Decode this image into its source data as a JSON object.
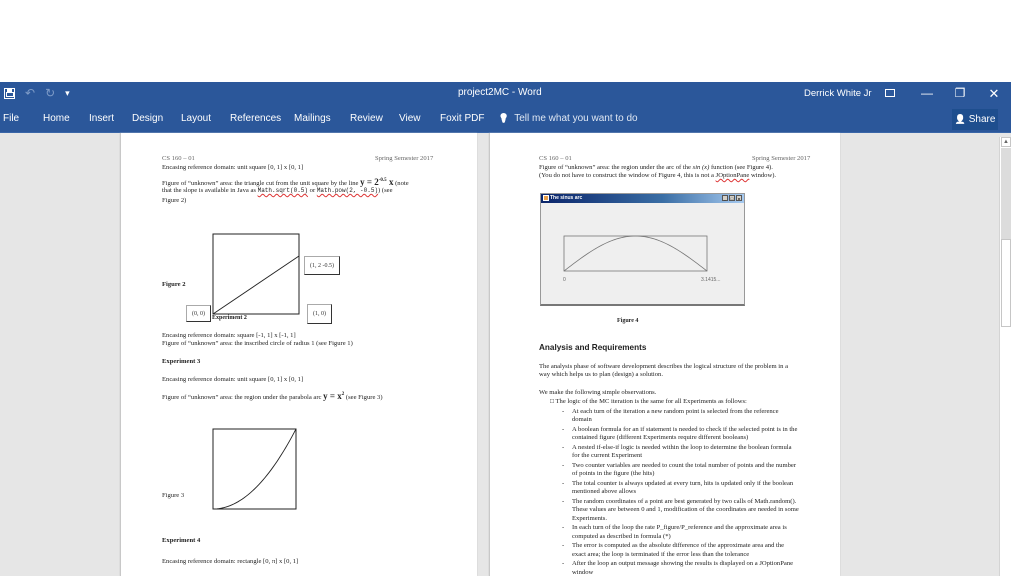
{
  "window": {
    "doc_title": "project2MC  -  Word",
    "user": "Derrick White Jr",
    "qat": {
      "undo": "↶",
      "redo": "↻",
      "customize": "▾"
    },
    "controls": {
      "ribbon_display": "▣",
      "minimize": "—",
      "restore": "❐",
      "close": "✕"
    }
  },
  "ribbon": {
    "tabs": [
      "File",
      "Home",
      "Insert",
      "Design",
      "Layout",
      "References",
      "Mailings",
      "Review",
      "View",
      "Foxit PDF"
    ],
    "tell_me": "Tell me what you want to do",
    "tell_me_icon": "💡",
    "share": "Share",
    "share_icon": "👤"
  },
  "page1": {
    "header_left": "CS 160 – 01",
    "header_right": "Spring Semester 2017",
    "exp2_domain": "Encasing reference domain: unit square [0, 1] x [0, 1]",
    "exp2_figure_a": "Figure of “unknown” area: the triangle cut from the unit square by the line",
    "exp2_eq_y": "y = 2",
    "exp2_eq_exp": "-0.5",
    "exp2_eq_x": "x",
    "exp2_note": "(note",
    "exp2_line2_a": "that the slope is available in Java as",
    "exp2_code1": "Math.sqrt(0.5)",
    "exp2_line2_b": "or",
    "exp2_code2": "Math.pow(2, -0.5)",
    "exp2_line2_c": ") (see",
    "exp2_line3": "Figure 2)",
    "fig2_label": "Figure 2",
    "fig2_corner_top": "(1, 2 -0.5)",
    "fig2_corner_origin": "(0, 0)",
    "fig2_corner_right": "(1, 0)",
    "exp2_caption": "Experiment 2",
    "exp1_domain": "Encasing reference domain: square [-1, 1] x [-1, 1]",
    "exp1_figure": "Figure of “unknown” area: the inscribed circle of radius 1 (see Figure 1)",
    "exp3_heading": "Experiment 3",
    "exp3_domain": "Encasing reference domain: unit square [0, 1] x [0, 1]",
    "exp3_figure": "Figure of “unknown” area: the region under the parabola arc",
    "exp3_eq": "y = x",
    "exp3_eq_sup": "2",
    "exp3_see": "(see Figure 3)",
    "fig3_label": "Figure 3",
    "exp4_heading": "Experiment 4",
    "exp4_domain": "Encasing reference domain: rectangle [0, π] x [0, 1]"
  },
  "page2": {
    "header_left": "CS 160 – 01",
    "header_right": "Spring Semester 2017",
    "exp4_figure_a": "Figure of “unknown” area: the region under the arc of the",
    "exp4_sin": "sin (x)",
    "exp4_figure_b": "function (see Figure 4).",
    "exp4_note_a": "(You do not have to construct the window of Figure 4, this is not a",
    "exp4_note_code": "JOptionPane",
    "exp4_note_b": "window).",
    "java_window_title": "The sinus arc",
    "java_ctrls": [
      "_",
      "□",
      "x"
    ],
    "tick_start": "0",
    "tick_end": "3.1415...",
    "fig4_label": "Figure 4",
    "analysis_heading": "Analysis and Requirements",
    "analysis_p1_l1": "The analysis phase of software development describes the logical structure of the problem in a",
    "analysis_p1_l2": "way which helps us to plan (design) a solution.",
    "analysis_p2": "We make the following simple observations.",
    "bullet_main": "□ The logic of the MC iteration is the same for all Experiments as follows:",
    "bullets": [
      [
        "At each turn of the iteration a new random point is selected from the reference",
        "domain"
      ],
      [
        "A boolean formula for an if statement is needed to check if the selected point is in the",
        "contained figure (different Experiments require different booleans)"
      ],
      [
        "A nested if-else-if logic is needed within the loop to determine the boolean formula",
        "for the current Experiment"
      ],
      [
        "Two counter variables are needed to count the total number of points and the number",
        "of points in the figure (the hits)"
      ],
      [
        "The total counter is always updated at every turn, hits is updated only if the boolean",
        "mentioned above allows"
      ],
      [
        "The random coordinates of a point are best generated by two calls of Math.random().",
        "These values are between 0 and 1, modification of the coordinates are needed in some",
        "Experiments."
      ],
      [
        "In each turn of the loop the rate P_figure/P_reference and the approximate area is",
        "computed as described in formula (*)"
      ],
      [
        "The error is computed as the absolute difference of the approximate area and the",
        "exact area; the loop is terminated if the error less than the tolerance"
      ],
      [
        "After the loop an output message showing the results is displayed on a JOptionPane",
        "window"
      ]
    ]
  },
  "colors": {
    "ribbon": "#2b579a",
    "workspace": "#e6e6e6",
    "share_bg": "#1e4e8e"
  }
}
